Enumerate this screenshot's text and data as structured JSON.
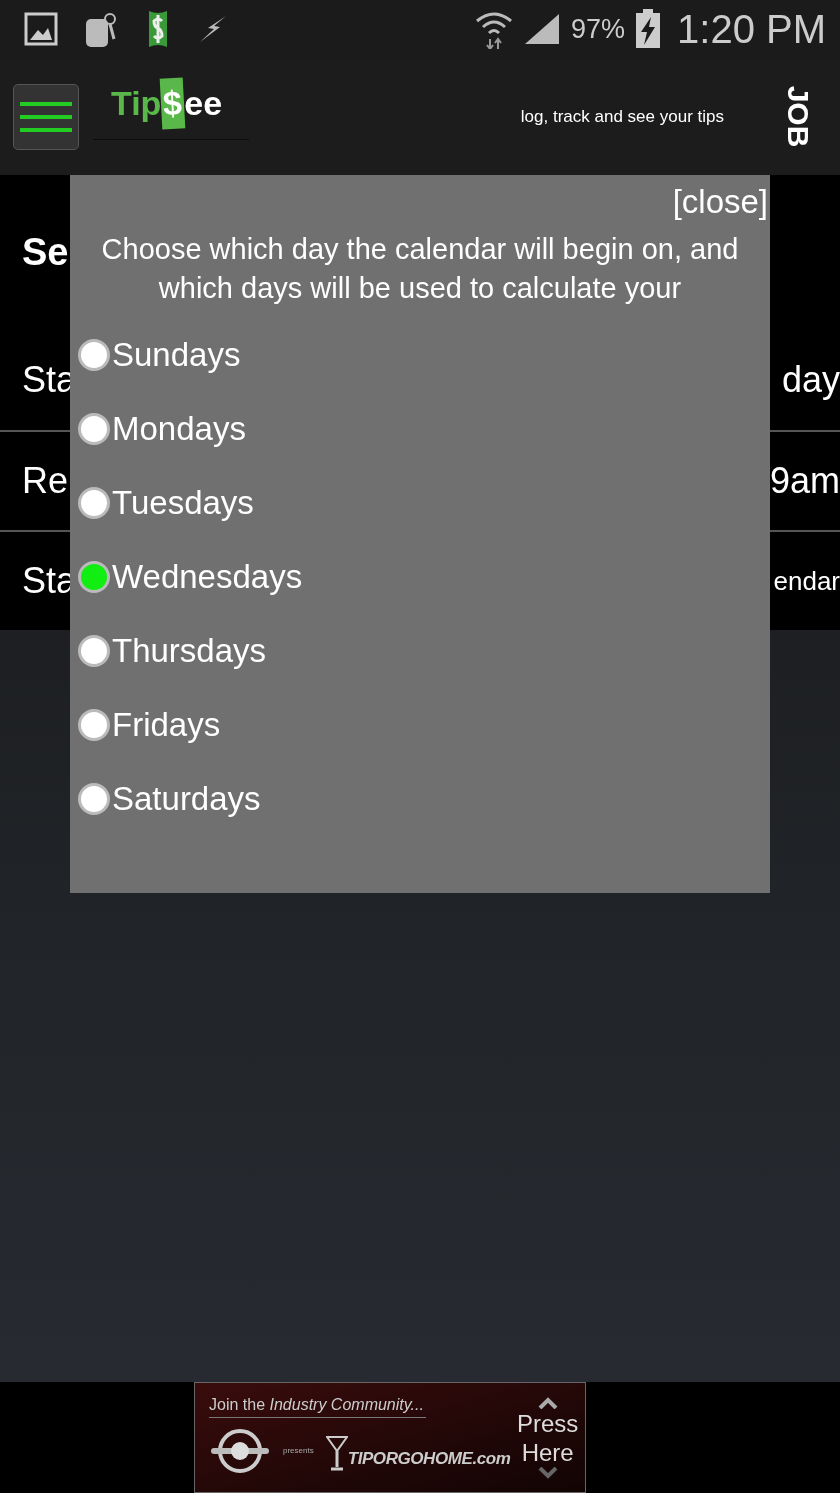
{
  "status_bar": {
    "battery": "97%",
    "time": "1:20 PM"
  },
  "header": {
    "logo": [
      "Tip",
      "$",
      "ee"
    ],
    "tagline": "log, track and see your tips",
    "job_tab": "JOB"
  },
  "background": {
    "title": "Se",
    "rows": [
      {
        "left": "Sta",
        "right": "day"
      },
      {
        "left": "Re",
        "right": "9am"
      },
      {
        "left": "Sta",
        "right": "endar"
      }
    ]
  },
  "dialog": {
    "close": "[close]",
    "description": "Choose which day the calendar will begin on, and which days will be used to calculate your",
    "options": [
      {
        "label": "Sundays",
        "selected": false
      },
      {
        "label": "Mondays",
        "selected": false
      },
      {
        "label": "Tuesdays",
        "selected": false
      },
      {
        "label": "Wednesdays",
        "selected": true
      },
      {
        "label": "Thursdays",
        "selected": false
      },
      {
        "label": "Fridays",
        "selected": false
      },
      {
        "label": "Saturdays",
        "selected": false
      }
    ]
  },
  "ad": {
    "headline": "Join the *Industry Community...*",
    "presents": "presents",
    "brand": "TIPORGOHOME.com",
    "button": [
      "Press",
      "Here"
    ]
  }
}
